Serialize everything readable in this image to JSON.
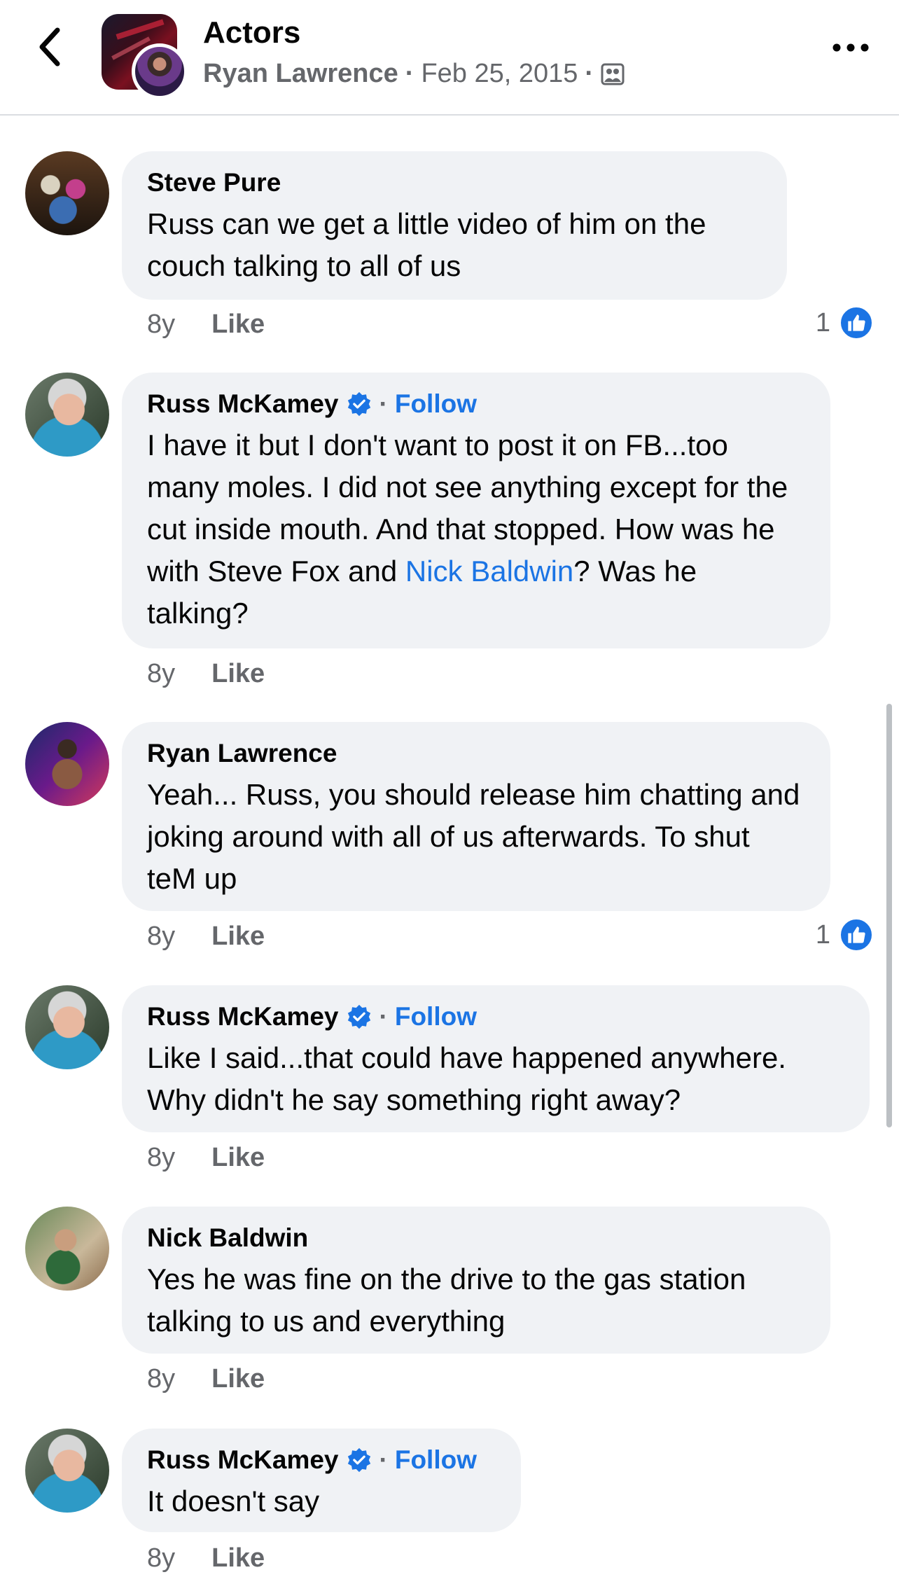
{
  "header": {
    "title": "Actors",
    "poster": "Ryan Lawrence",
    "sep1": "·",
    "date": "Feb 25, 2015",
    "sep2": "·",
    "privacy_icon": "group-privacy-icon"
  },
  "comments": [
    {
      "author": "Steve Pure",
      "verified": false,
      "text": "Russ can we get a little video of him on the couch talking to all of us",
      "time": "8y",
      "like_label": "Like",
      "reactions": "1"
    },
    {
      "author": "Russ McKamey",
      "verified": true,
      "follow_sep": "·",
      "follow_label": "Follow",
      "text_before": "I have it but I don't want to post it on FB...too many moles. I did not see anything except for the cut inside mouth. And that stopped. How was he with Steve Fox and ",
      "mention": "Nick Baldwin",
      "text_after": "? Was he talking?",
      "time": "8y",
      "like_label": "Like"
    },
    {
      "author": "Ryan Lawrence",
      "verified": false,
      "text": "Yeah... Russ, you should release him chatting and joking around with all of us afterwards. To shut teM up",
      "time": "8y",
      "like_label": "Like",
      "reactions": "1"
    },
    {
      "author": "Russ McKamey",
      "verified": true,
      "follow_sep": "·",
      "follow_label": "Follow",
      "text": "Like I said...that could have happened anywhere. Why didn't he say something right away?",
      "time": "8y",
      "like_label": "Like"
    },
    {
      "author": "Nick Baldwin",
      "verified": false,
      "text": "Yes he was fine on the drive to the gas station talking to us and everything",
      "time": "8y",
      "like_label": "Like"
    },
    {
      "author": "Russ McKamey",
      "verified": true,
      "follow_sep": "·",
      "follow_label": "Follow",
      "text": "It doesn't say",
      "time": "8y",
      "like_label": "Like"
    }
  ],
  "colors": {
    "accent": "#1b74e4",
    "bubble": "#f0f2f5",
    "secondary_text": "#65676b"
  }
}
